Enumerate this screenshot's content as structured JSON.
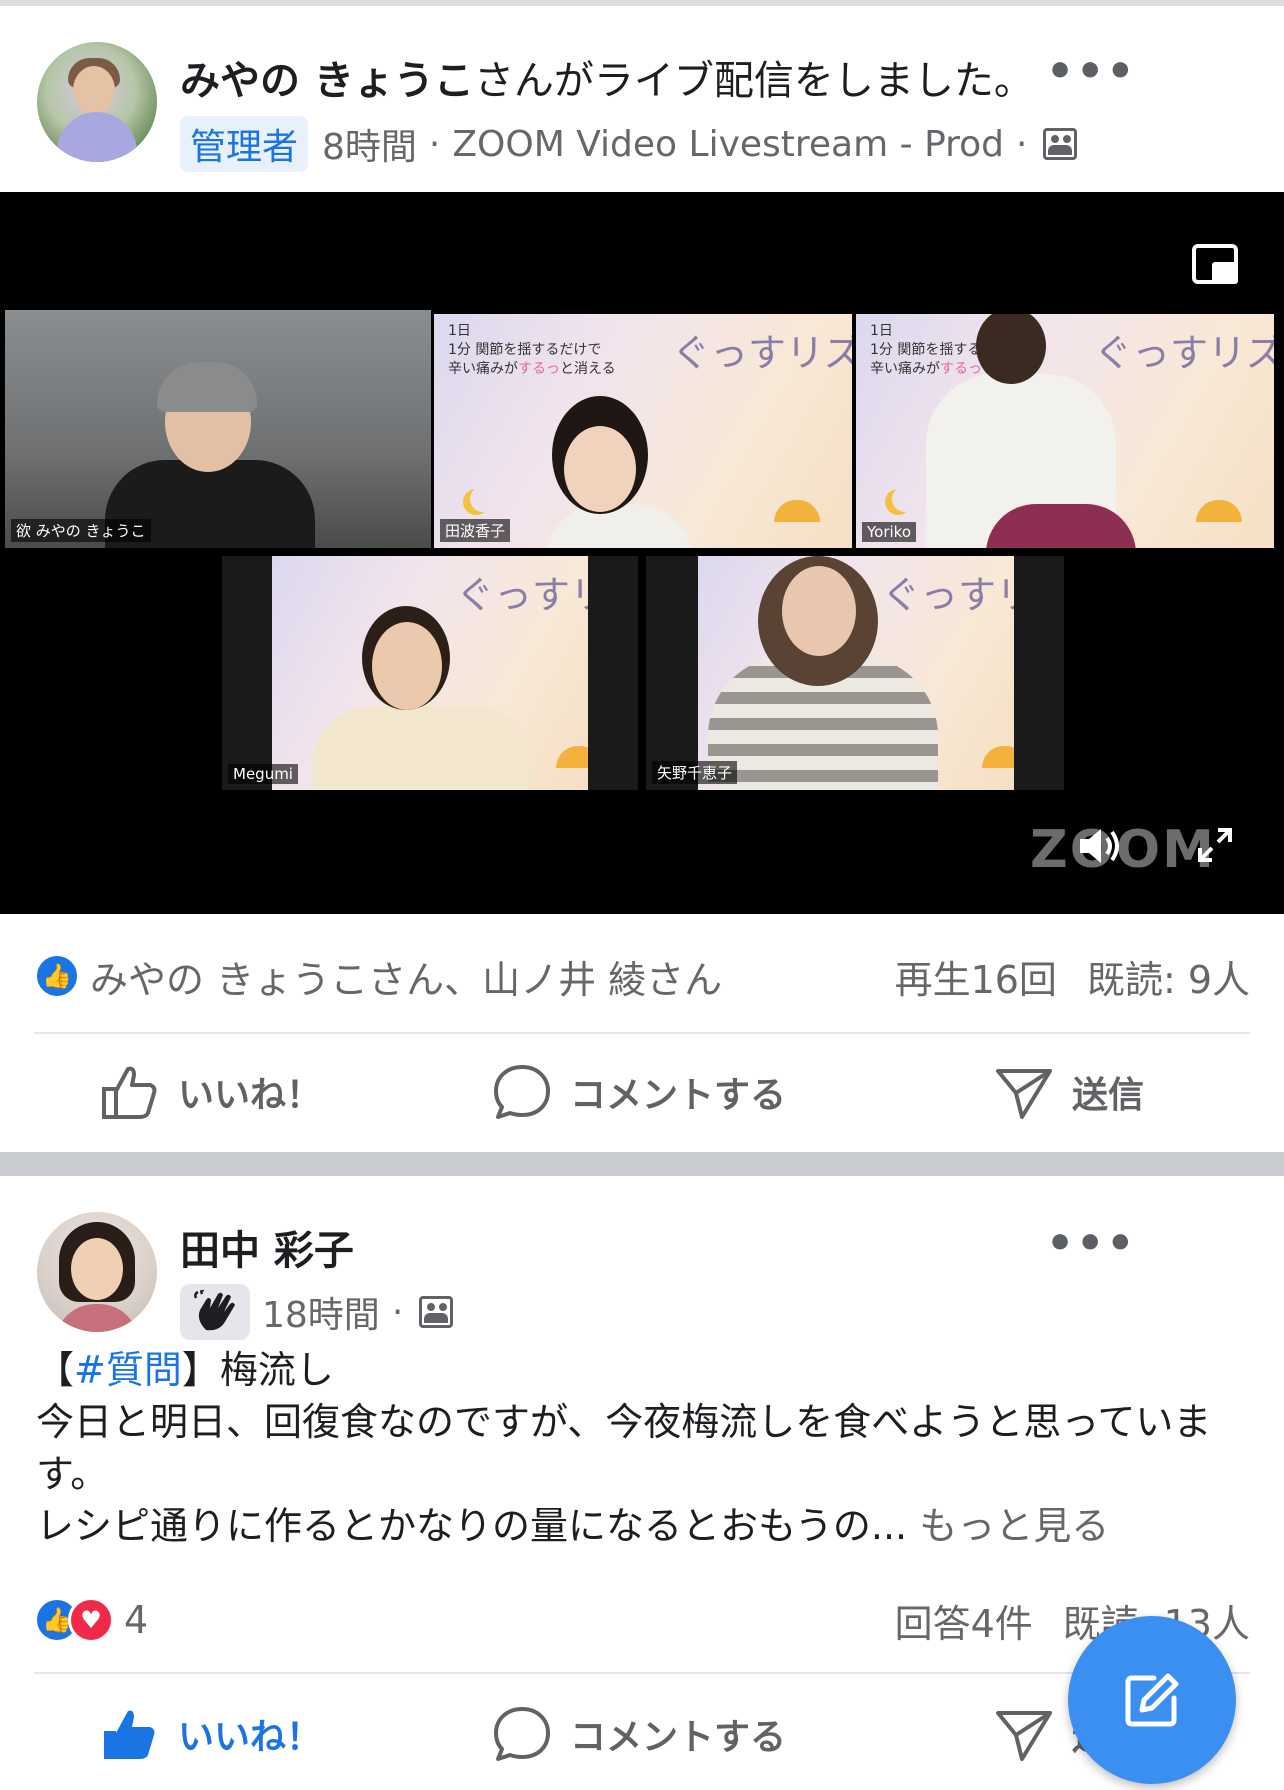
{
  "post1": {
    "author": "みやの きょうこ",
    "action_text": "さんがライブ配信をしました。",
    "badge": "管理者",
    "time": "8時間",
    "source": "ZOOM Video Livestream - Prod",
    "video": {
      "participants": [
        {
          "name": "欲 みやの きょうこ"
        },
        {
          "name": "田波香子"
        },
        {
          "name": "Yoriko"
        },
        {
          "name": "Megumi"
        },
        {
          "name": "矢野千恵子"
        }
      ],
      "slide_title": "ぐっすリズム",
      "slide_sub_1": "1日",
      "slide_sub_2": "1分 関節を揺するだけで",
      "slide_sub_3a": "辛い痛みが",
      "slide_sub_3b": "するっ",
      "slide_sub_3c": "と消える",
      "watermark": "ZOOM"
    },
    "reactions_names": "みやの きょうこさん、山ノ井 綾さん",
    "plays": "再生16回",
    "seen": "既読: 9人",
    "actions": {
      "like": "いいね！",
      "comment": "コメントする",
      "send": "送信"
    }
  },
  "post2": {
    "author": "田中 彩子",
    "time": "18時間",
    "hashtag_open": "【",
    "hashtag": "#質問",
    "hashtag_close": "】梅流し",
    "line1": "今日と明日、回復食なのですが、今夜梅流しを食べようと思っています。",
    "line2": "レシピ通りに作るとかなりの量になるとおもうの...",
    "see_more": "もっと見る",
    "reaction_count": "4",
    "answers": "回答4件",
    "seen": "既読: 13人",
    "actions": {
      "like": "いいね！",
      "comment": "コメントする",
      "send": "送信"
    }
  },
  "colors": {
    "accent": "#1b74e4",
    "heart": "#f02849",
    "fab": "#3a8ff0",
    "speaker_border": "#6bcf3f"
  }
}
